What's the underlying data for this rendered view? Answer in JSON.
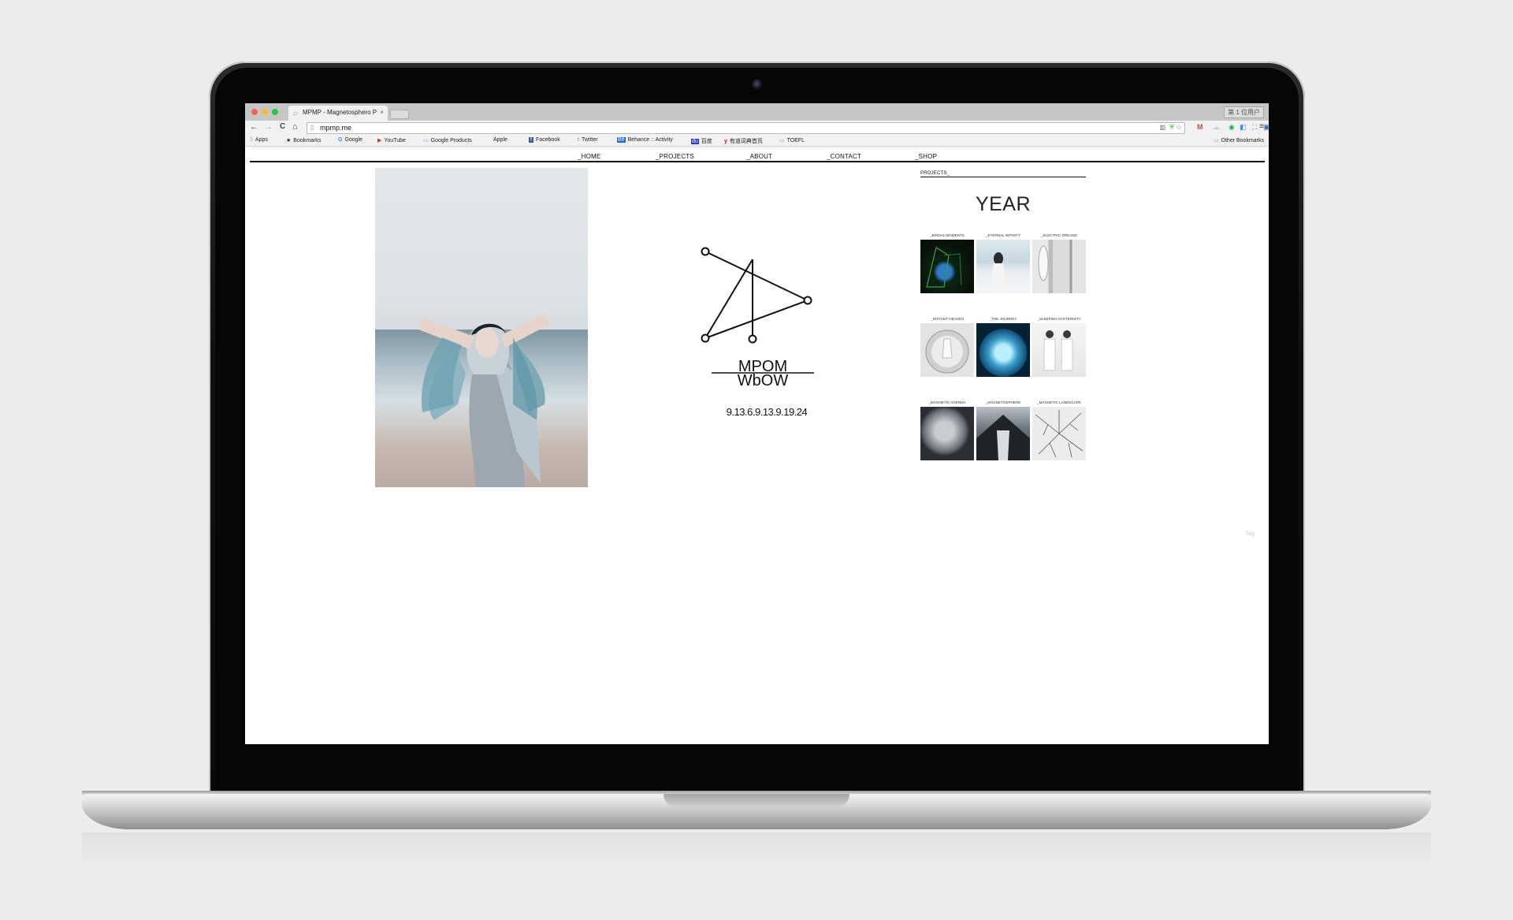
{
  "browser": {
    "tab_title": "MPMP - Magnetosphero P",
    "tab_close": "×",
    "profile_label": "第 1 位用户",
    "url": "mpmp.me",
    "nav": {
      "back": "←",
      "forward": "→",
      "reload": "C",
      "home": "⌂"
    },
    "menu_icon": "≡"
  },
  "bookmarks": [
    {
      "label": "Apps",
      "icon": "⁞⁞"
    },
    {
      "label": "Bookmarks",
      "icon": "★"
    },
    {
      "label": "Google",
      "icon": "G"
    },
    {
      "label": "YouTube",
      "icon": "▶"
    },
    {
      "label": "Google Products",
      "icon": "▭"
    },
    {
      "label": "Apple",
      "icon": ""
    },
    {
      "label": "Facebook",
      "icon": "f"
    },
    {
      "label": "Twitter",
      "icon": "t"
    },
    {
      "label": "Behance :: Activity",
      "icon": "Bē"
    },
    {
      "label": "百度",
      "icon": "du"
    },
    {
      "label": "有道词典首页",
      "icon": "y"
    },
    {
      "label": "TOEFL",
      "icon": "▭"
    }
  ],
  "other_bookmarks": "Other Bookmarks",
  "site": {
    "nav": [
      "_HOME",
      "_PROJECTS",
      "_ABOUT",
      "_CONTACT",
      "_SHOP"
    ],
    "logo_text_top": "MPOM",
    "logo_text_bottom": "WbOW",
    "logo_date": "9.13.6.9.13.9.19.24",
    "sidebar_title": "PROJECTS_",
    "year_label": "YEAR",
    "projects": [
      {
        "caption": "_BRIDAL MOMENTS",
        "palette": "#0b1a10"
      },
      {
        "caption": "_ETERNAL INFINITY",
        "palette": "#c9dbe4"
      },
      {
        "caption": "_ELECTRIC DREAMS",
        "palette": "#cfcfcf"
      },
      {
        "caption": "_INSTANT HEAVEN",
        "palette": "#d8d8d8"
      },
      {
        "caption": "_THE JOURNEY",
        "palette": "#0e3a57"
      },
      {
        "caption": "_SLEEPING IN ETERNITY",
        "palette": "#ececec"
      },
      {
        "caption": "_MAGNETIC AGENDA",
        "palette": "#4a4f54"
      },
      {
        "caption": "_MAGNETOSPHERE",
        "palette": "#3a4048"
      },
      {
        "caption": "_MAGNETIC LANDSCAPE",
        "palette": "#e2e2e2"
      }
    ],
    "tag_text": "Tag"
  }
}
